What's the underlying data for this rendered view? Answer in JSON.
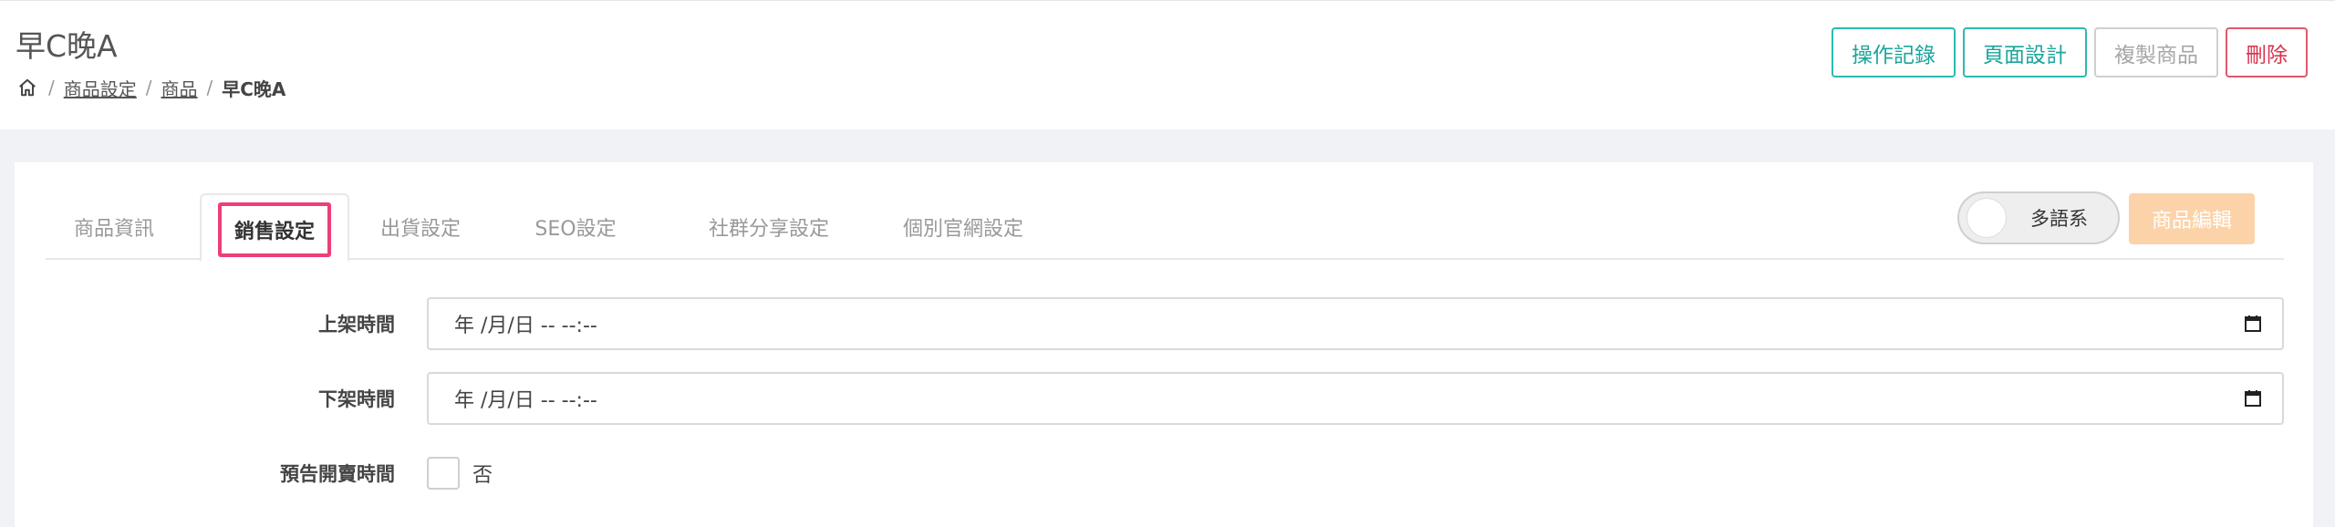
{
  "header": {
    "title": "早C晚A",
    "breadcrumb": {
      "home_icon": "home-icon",
      "separator": "/",
      "items": [
        "商品設定",
        "商品"
      ],
      "current": "早C晚A"
    },
    "actions": {
      "history_label": "操作記錄",
      "page_design_label": "頁面設計",
      "copy_label": "複製商品",
      "delete_label": "刪除"
    }
  },
  "tabs": [
    {
      "label": "商品資訊",
      "active": false
    },
    {
      "label": "銷售設定",
      "active": true
    },
    {
      "label": "出貨設定",
      "active": false
    },
    {
      "label": "SEO設定",
      "active": false
    },
    {
      "label": "社群分享設定",
      "active": false
    },
    {
      "label": "個別官網設定",
      "active": false
    }
  ],
  "toolbar": {
    "lang_toggle_label": "多語系",
    "lang_toggle_on": false,
    "edit_label": "商品編輯"
  },
  "form": {
    "publish_time": {
      "label": "上架時間",
      "value": "年 /月/日 -- --:--"
    },
    "unpublish_time": {
      "label": "下架時間",
      "value": "年 /月/日 -- --:--"
    },
    "preorder_time": {
      "label": "預告開賣時間",
      "checkbox_label": "否",
      "checked": false
    }
  },
  "colors": {
    "teal": "#1aa69c",
    "red": "#d9314b",
    "active_tab_highlight": "#ec3f79",
    "edit_button": "#fcd3a8"
  }
}
